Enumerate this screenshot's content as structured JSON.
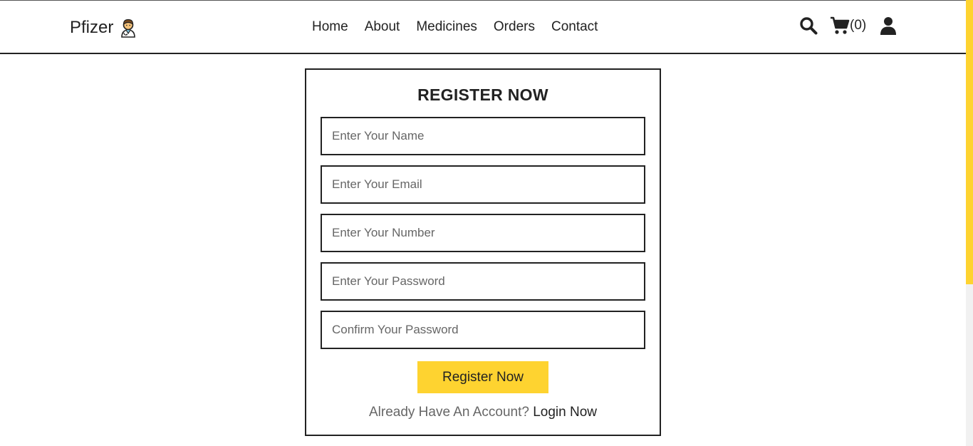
{
  "header": {
    "logo_text": "Pfizer",
    "logo_icon": "doctor-icon",
    "nav": [
      "Home",
      "About",
      "Medicines",
      "Orders",
      "Contact"
    ],
    "cart_count": "(0)",
    "icons": [
      "search-icon",
      "cart-icon",
      "user-icon"
    ]
  },
  "form": {
    "title": "REGISTER NOW",
    "fields": [
      {
        "placeholder": "Enter Your Name",
        "value": ""
      },
      {
        "placeholder": "Enter Your Email",
        "value": ""
      },
      {
        "placeholder": "Enter Your Number",
        "value": ""
      },
      {
        "placeholder": "Enter Your Password",
        "value": ""
      },
      {
        "placeholder": "Confirm Your Password",
        "value": ""
      }
    ],
    "submit_label": "Register Now",
    "switch_text": "Already Have An Account?",
    "switch_link": "Login Now"
  },
  "colors": {
    "accent": "#fed330",
    "text": "#222222",
    "muted": "#666666"
  }
}
